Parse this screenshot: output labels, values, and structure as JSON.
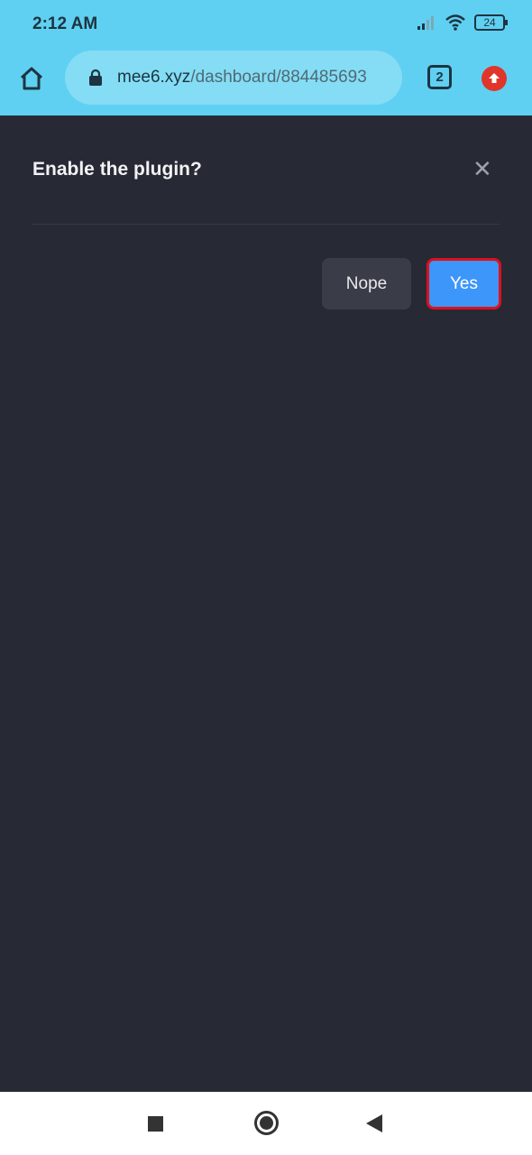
{
  "status_bar": {
    "time": "2:12 AM",
    "battery": "24",
    "icons": [
      "signal-icon",
      "wifi-icon",
      "battery-icon"
    ]
  },
  "browser": {
    "url_domain": "mee6.xyz",
    "url_path": "/dashboard/884485693",
    "tab_count": "2",
    "icons": [
      "home-icon",
      "lock-icon",
      "tabs-icon",
      "update-icon"
    ]
  },
  "dialog": {
    "title": "Enable the plugin?",
    "nope_label": "Nope",
    "yes_label": "Yes",
    "colors": {
      "background": "#272a35",
      "yes": "#3d96f9",
      "nope": "#3a3d48",
      "highlight": "#e0101a"
    }
  },
  "nav_bar": {
    "icons": [
      "recent-apps-icon",
      "home-circle-icon",
      "back-icon"
    ]
  }
}
